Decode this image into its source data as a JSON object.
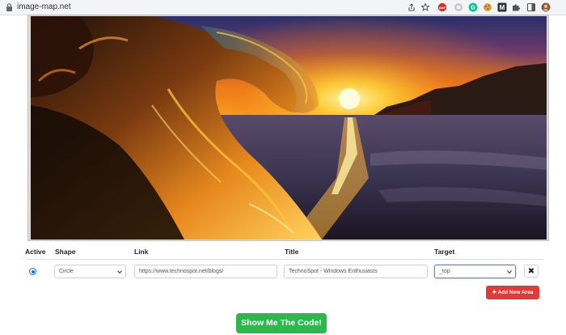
{
  "browser": {
    "url": "image-map.net",
    "extensions": [
      "share-icon",
      "star-icon",
      "adblock-icon",
      "grey-extension-icon",
      "grammarly-icon",
      "cookie-icon",
      "m-extension-icon",
      "puzzle-icon",
      "side-panel-icon",
      "profile-avatar-icon"
    ]
  },
  "table": {
    "headers": {
      "active": "Active",
      "shape": "Shape",
      "link": "Link",
      "title": "Title",
      "target": "Target"
    },
    "row": {
      "active": true,
      "shape": "Circle",
      "link": "https://www.technospot.net/blogs/",
      "title": "TechnoSpot - Windows Enthusiasts",
      "target": "_top",
      "delete_label": "✖"
    }
  },
  "buttons": {
    "add_new_area": "Add New Area",
    "show_code": "Show Me The Code!"
  },
  "colors": {
    "accent_blue": "#1a6de0",
    "danger_red": "#e03a3a",
    "success_green": "#2db84c"
  }
}
